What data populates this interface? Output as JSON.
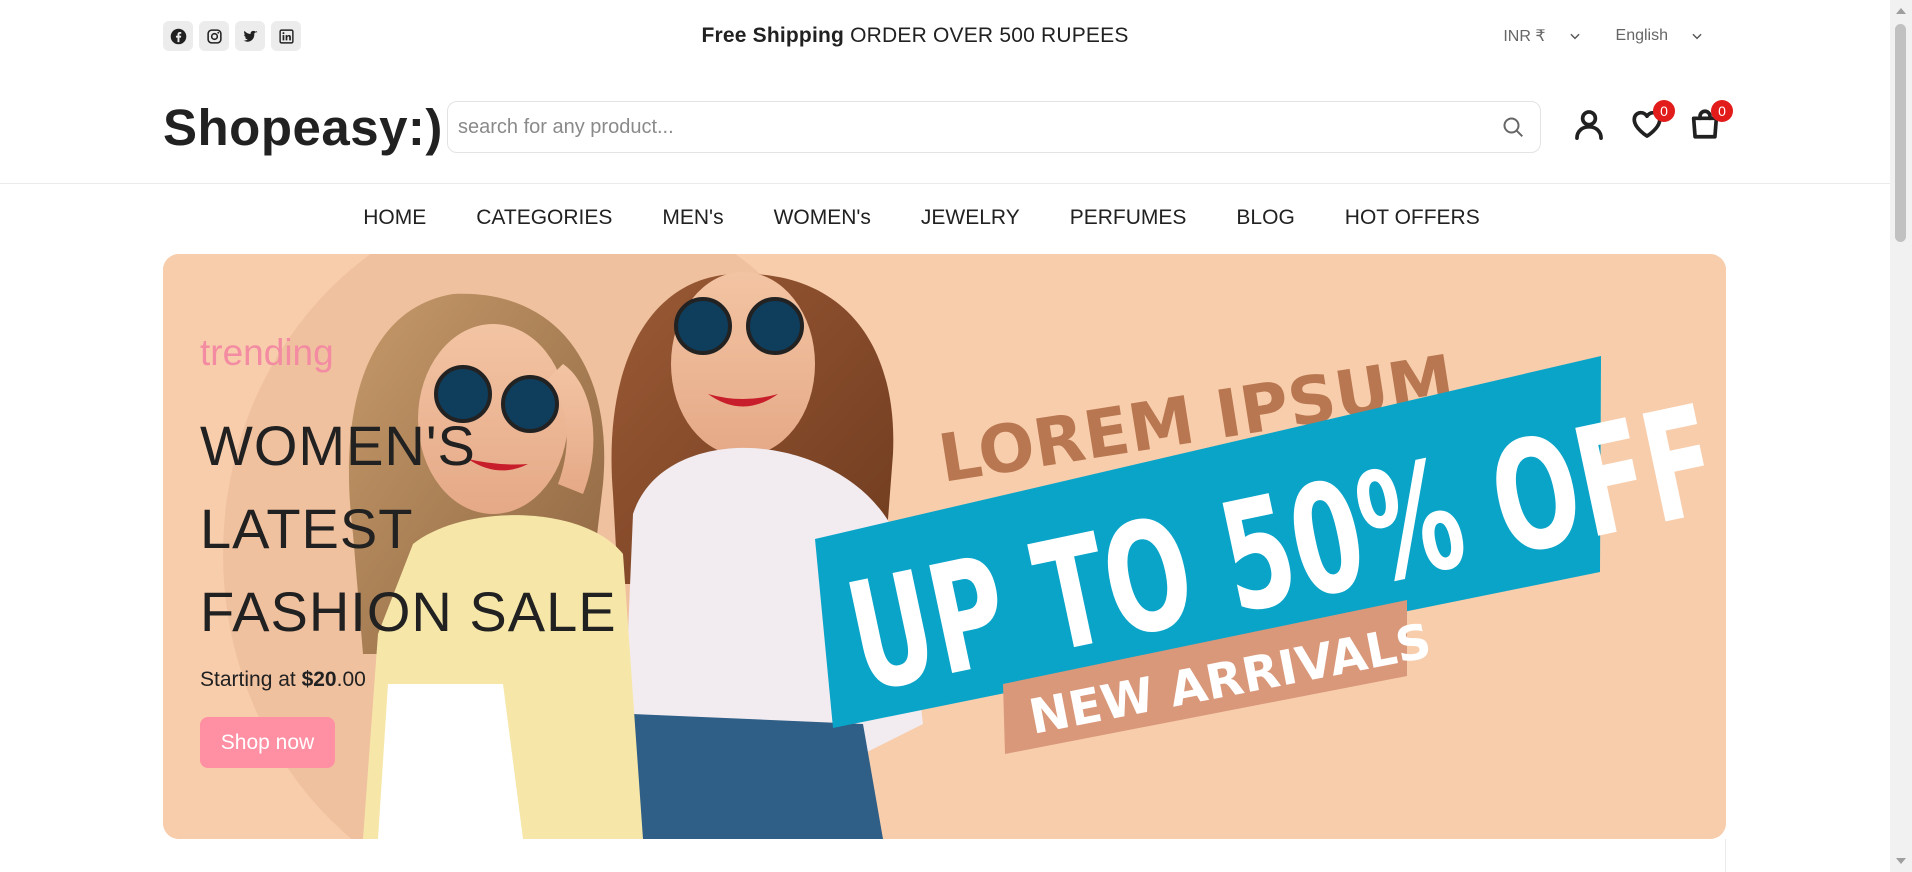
{
  "topbar": {
    "socials": [
      {
        "icon": "facebook-icon"
      },
      {
        "icon": "instagram-icon"
      },
      {
        "icon": "twitter-icon"
      },
      {
        "icon": "linkedin-icon"
      }
    ],
    "promo_bold": "Free Shipping",
    "promo_text": "ORDER OVER 500 RUPEES",
    "currency": "INR ₹",
    "language": "English"
  },
  "header": {
    "logo": "Shopeasy:)",
    "search_placeholder": "search for any product...",
    "wishlist_count": "0",
    "cart_count": "0"
  },
  "nav": {
    "items": [
      "HOME",
      "CATEGORIES",
      "MEN's",
      "WOMEN's",
      "JEWELRY",
      "PERFUMES",
      "BLOG",
      "HOT OFFERS"
    ]
  },
  "hero": {
    "subtitle": "trending",
    "title_line1": "WOMEN'S",
    "title_line2": "LATEST",
    "title_line3": "FASHION SALE",
    "price_prefix": "Starting at ",
    "price_bold": "$20",
    "price_suffix": ".00",
    "button": "Shop now",
    "banner_top": "LOREM IPSUM",
    "banner_main": "UP TO 50% OFF",
    "banner_bottom": "NEW ARRIVALS"
  },
  "colors": {
    "accent_pink": "#ff8fa3",
    "trending_pink": "#f38ba2",
    "banner_blue": "#0aa4c8",
    "badge_red": "#e21b1b",
    "hero_bg": "#f8cfb0"
  }
}
